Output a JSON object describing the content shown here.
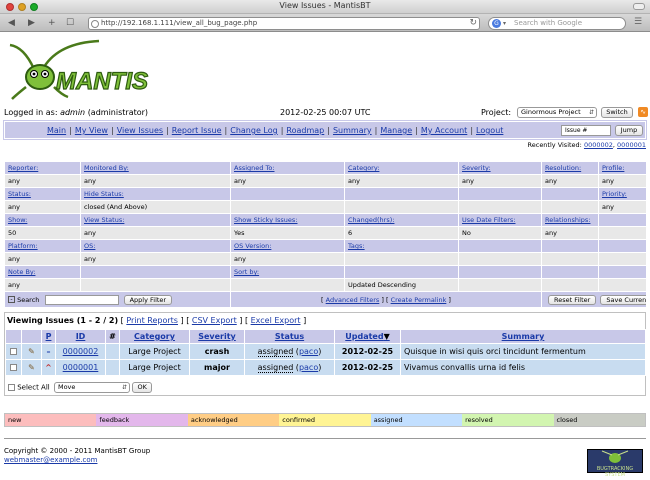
{
  "browser": {
    "window_title": "View Issues - MantisBT",
    "url": "http://192.168.1.111/view_all_bug_page.php",
    "search_placeholder": "Search with Google"
  },
  "header": {
    "logo_text": "MANTIS",
    "logged_in_label": "Logged in as:",
    "username": "admin",
    "role": "(administrator)",
    "datetime": "2012-02-25 00:07 UTC",
    "project_label": "Project:",
    "project_selected": "Ginormous Project",
    "switch_label": "Switch"
  },
  "menu": {
    "items": [
      "Main",
      "My View",
      "View Issues",
      "Report Issue",
      "Change Log",
      "Roadmap",
      "Summary",
      "Manage",
      "My Account",
      "Logout"
    ],
    "issue_placeholder": "Issue #",
    "jump_label": "Jump"
  },
  "recently_visited": {
    "label": "Recently Visited:",
    "items": [
      "0000002",
      "0000001"
    ]
  },
  "filters": {
    "rows": [
      {
        "labels": [
          "Reporter:",
          "Monitored By:",
          "Assigned To:",
          "Category:",
          "Severity:",
          "Resolution:",
          "Profile:"
        ],
        "values": [
          "any",
          "any",
          "any",
          "any",
          "any",
          "any",
          "any"
        ]
      },
      {
        "labels": [
          "Status:",
          "Hide Status:",
          "",
          "",
          "",
          "",
          "Priority:"
        ],
        "values": [
          "any",
          "closed (And Above)",
          "",
          "",
          "",
          "",
          "any"
        ]
      },
      {
        "labels": [
          "Show:",
          "View Status:",
          "Show Sticky Issues:",
          "Changed(hrs):",
          "Use Date Filters:",
          "Relationships:",
          ""
        ],
        "values": [
          "50",
          "any",
          "Yes",
          "6",
          "No",
          "any",
          ""
        ]
      },
      {
        "labels": [
          "Platform:",
          "OS:",
          "OS Version:",
          "Tags:",
          "",
          "",
          ""
        ],
        "values": [
          "any",
          "any",
          "any",
          "",
          "",
          "",
          ""
        ]
      },
      {
        "labels": [
          "Note By:",
          "",
          "Sort by:",
          "",
          "",
          "",
          ""
        ],
        "values": [
          "any",
          "",
          "",
          "Updated Descending",
          "",
          "",
          ""
        ]
      }
    ],
    "search_label": "Search",
    "apply_label": "Apply Filter",
    "advanced_label": "Advanced Filters",
    "permalink_label": "Create Permalink",
    "reset_label": "Reset Filter",
    "save_label": "Save Current Filter"
  },
  "issues": {
    "title": "Viewing Issues (1 - 2 / 2)",
    "print_label": "Print Reports",
    "csv_label": "CSV Export",
    "excel_label": "Excel Export",
    "columns": [
      "",
      "",
      "P",
      "ID",
      "#",
      "Category",
      "Severity",
      "Status",
      "Updated",
      "Summary"
    ],
    "rows": [
      {
        "id": "0000002",
        "category": "Large Project",
        "severity": "crash",
        "status": "assigned",
        "handler": "paco",
        "updated": "2012-02-25",
        "summary": "Quisque in wisi quis orci tincidunt fermentum"
      },
      {
        "id": "0000001",
        "category": "Large Project",
        "severity": "major",
        "status": "assigned",
        "handler": "paco",
        "updated": "2012-02-25",
        "summary": "Vivamus convallis urna id felis"
      }
    ],
    "select_all_label": "Select All",
    "action_selected": "Move",
    "ok_label": "OK"
  },
  "status_legend": [
    {
      "label": "new",
      "color": "#fcbdbd"
    },
    {
      "label": "feedback",
      "color": "#e3b7eb"
    },
    {
      "label": "acknowledged",
      "color": "#ffcd85"
    },
    {
      "label": "confirmed",
      "color": "#fff494"
    },
    {
      "label": "assigned",
      "color": "#c2dfff"
    },
    {
      "label": "resolved",
      "color": "#d2f5b0"
    },
    {
      "label": "closed",
      "color": "#c9ccc4"
    }
  ],
  "footer": {
    "copyright": "Copyright © 2000 - 2011 MantisBT Group",
    "email": "webmaster@example.com",
    "badge_text": "BUGTRACKING SYSTEM"
  },
  "icons": {
    "back": "back-icon",
    "forward": "forward-icon",
    "add": "add-tab-icon",
    "rss": "rss-icon",
    "edit": "pencil-icon"
  }
}
